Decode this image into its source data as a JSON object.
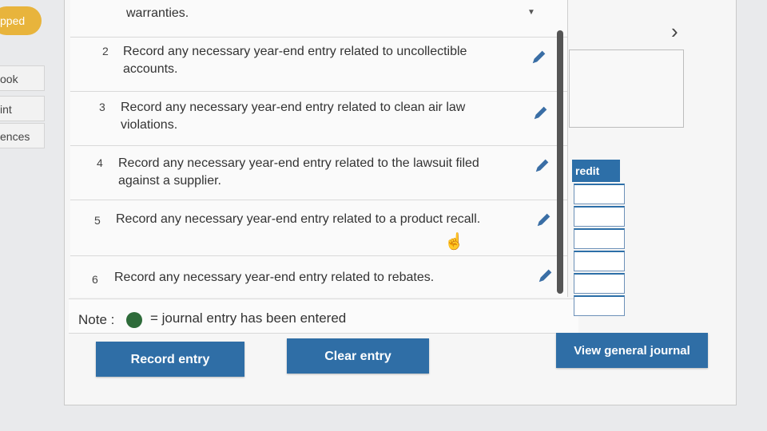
{
  "sidebar": {
    "status_pill": "pped",
    "tabs": [
      "ook",
      "int",
      "ences"
    ]
  },
  "list": {
    "partial_top_text": "warranties.",
    "items": [
      {
        "num": "2",
        "text": "Record any necessary year-end entry related to uncollectible accounts."
      },
      {
        "num": "3",
        "text": "Record any necessary year-end entry related to clean air law violations."
      },
      {
        "num": "4",
        "text": "Record any necessary year-end entry related to the lawsuit filed against a supplier."
      },
      {
        "num": "5",
        "text": "Record any necessary year-end entry related to a product recall."
      },
      {
        "num": "6",
        "text": "Record any necessary year-end entry related to rebates."
      }
    ]
  },
  "note": {
    "label": "Note :",
    "description": "= journal entry has been entered",
    "dot_color": "#2e6b3a"
  },
  "ledger": {
    "credit_header": "redit"
  },
  "buttons": {
    "record_entry": "Record entry",
    "clear_entry": "Clear entry",
    "view_general_journal": "View general journal"
  },
  "colors": {
    "primary_button": "#2f6ea6",
    "pill": "#e8b43c",
    "pencil": "#3a6ea5"
  },
  "icons": {
    "next": "chevron-right-icon",
    "edit": "pencil-icon",
    "cursor": "hand-pointer-icon"
  }
}
